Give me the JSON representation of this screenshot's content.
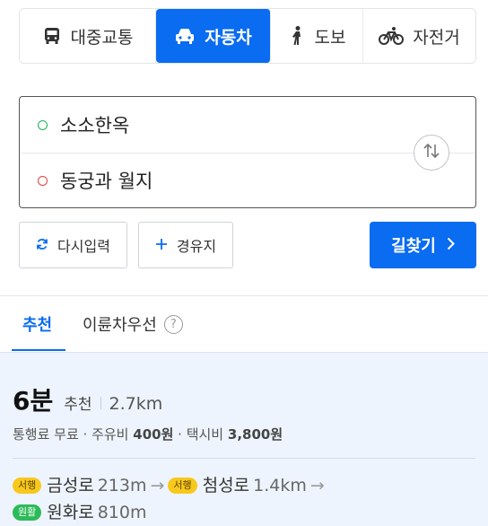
{
  "mode_tabs": [
    {
      "label": "대중교통",
      "icon": "bus-icon"
    },
    {
      "label": "자동차",
      "icon": "car-icon",
      "active": true
    },
    {
      "label": "도보",
      "icon": "walk-icon"
    },
    {
      "label": "자전거",
      "icon": "bicycle-icon"
    }
  ],
  "route": {
    "start": "소소한옥",
    "end": "동궁과 월지"
  },
  "actions": {
    "reset_label": "다시입력",
    "waypoint_label": "경유지",
    "search_label": "길찾기"
  },
  "option_tabs": {
    "recommend": "추천",
    "low_fare": "이륜차우선"
  },
  "result": {
    "time": "6분",
    "tag": "추천",
    "distance": "2.7km",
    "costs": {
      "prefix": "통행료 무료 · 주유비",
      "fuel": "400원",
      "taxi_prefix": " · 택시비",
      "taxi": "3,800원"
    },
    "roads": [
      {
        "badge": "서행",
        "status": "slow",
        "name": "금성로",
        "length": "213m"
      },
      {
        "badge": "서행",
        "status": "slow",
        "name": "첨성로",
        "length": "1.4km"
      },
      {
        "badge": "원활",
        "status": "smooth",
        "name": "원화로",
        "length": "810m"
      }
    ],
    "arrow": "→"
  },
  "colors": {
    "accent": "#0a6cf0",
    "slow_badge": "#f8c81d",
    "smooth_badge": "#2cbb58",
    "start_dot": "#1fb25a",
    "end_dot": "#e0443d"
  }
}
